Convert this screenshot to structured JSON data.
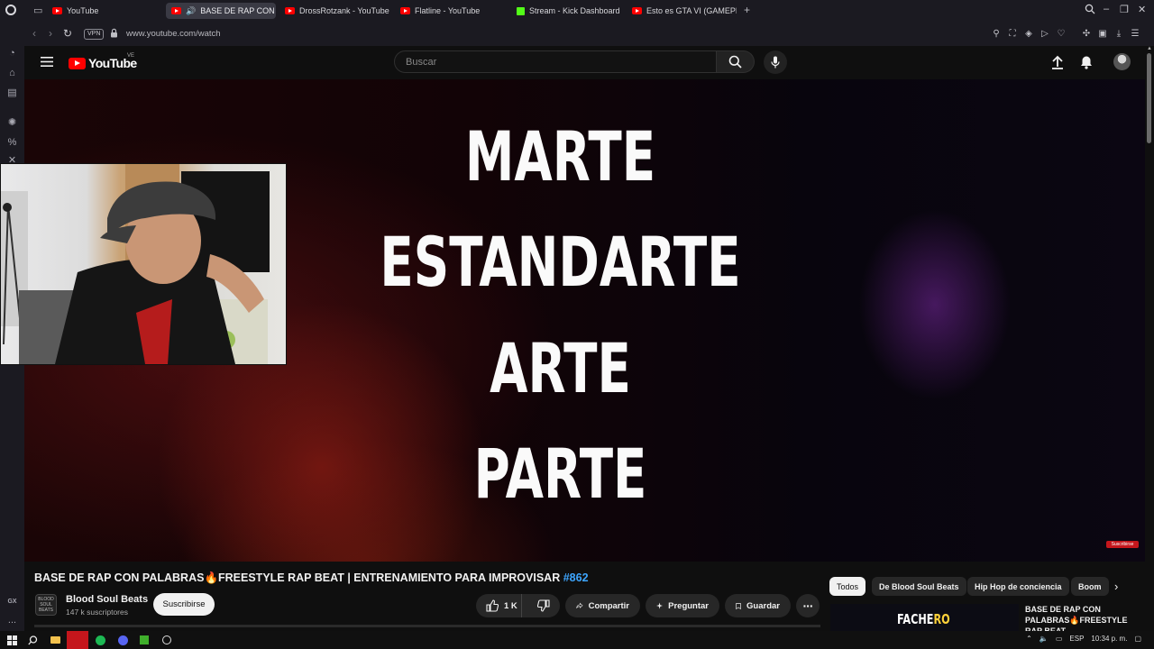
{
  "browser": {
    "tabs": [
      {
        "label": "YouTube",
        "favicon": "youtube-icon"
      },
      {
        "label": "BASE DE RAP CON PA",
        "favicon": "youtube-icon",
        "active": true,
        "audio": true
      },
      {
        "label": "DrossRotzank - YouTube",
        "favicon": "youtube-icon"
      },
      {
        "label": "Flatline - YouTube",
        "favicon": "youtube-icon"
      },
      {
        "label": "Stream - Kick Dashboard",
        "favicon": "kick-icon"
      },
      {
        "label": "Esto es GTA VI (GAMEPLAY",
        "favicon": "youtube-icon"
      }
    ],
    "vpn_label": "VPN",
    "url": "www.youtube.com/watch",
    "sidebar_labels": {
      "gx": "GX",
      "dots": "..."
    }
  },
  "youtube": {
    "logo_text": "YouTube",
    "region": "VE",
    "search_placeholder": "Buscar"
  },
  "video": {
    "lyrics": [
      "MARTE",
      "ESTANDARTE",
      "ARTE",
      "PARTE"
    ],
    "watermark": "Suscribirse",
    "title_main": "BASE DE RAP CON PALABRAS🔥FREESTYLE RAP BEAT | ENTRENAMIENTO PARA IMPROVISAR ",
    "title_hashtag": "#862",
    "channel": {
      "name": "Blood Soul Beats",
      "avatar_text": "BLOOD SOUL BEATS",
      "subscribers": "147 k suscriptores",
      "subscribe_label": "Suscribirse"
    },
    "actions": {
      "likes": "1 K",
      "share": "Compartir",
      "ask": "Preguntar",
      "save": "Guardar"
    }
  },
  "recommendations": {
    "chips": [
      "Todos",
      "De Blood Soul Beats",
      "Hip Hop de conciencia",
      "Boom"
    ],
    "first": {
      "thumb_text_a": "FACHE",
      "thumb_text_b": "RO",
      "title": "BASE DE RAP CON PALABRAS🔥FREESTYLE RAP BEAT..."
    }
  },
  "taskbar": {
    "lang": "ESP",
    "time": "10:34 p. m."
  },
  "colors": {
    "youtube_red": "#ff0000",
    "hashtag_blue": "#3ea6ff",
    "kick_green": "#53fc18",
    "bg": "#0f0f0f"
  }
}
